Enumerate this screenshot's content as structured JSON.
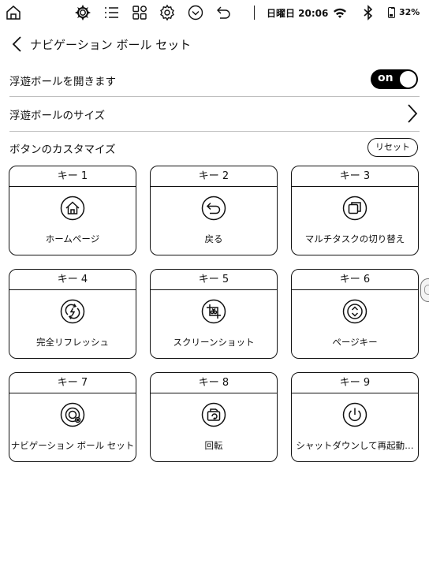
{
  "status_bar": {
    "datetime": "日曜日 20:06",
    "battery_percent": "32%",
    "battery_level": 0.32,
    "icons": [
      "home-outline-icon",
      "gear-flower-icon",
      "list-icon",
      "apps-grid-icon",
      "settings-gear-icon",
      "chevron-circle-icon",
      "undo-arrow-icon",
      "wifi-icon",
      "bluetooth-icon",
      "battery-icon"
    ]
  },
  "header": {
    "title": "ナビゲーション ボール セット"
  },
  "settings": {
    "open_ball_label": "浮遊ボールを開きます",
    "toggle_text": "on",
    "toggle_on": true,
    "ball_size_label": "浮遊ボールのサイズ",
    "customize_label": "ボタンのカスタマイズ",
    "reset_label": "リセット"
  },
  "keys": [
    {
      "title": "キー 1",
      "label": "ホームページ",
      "icon": "home-icon"
    },
    {
      "title": "キー 2",
      "label": "戻る",
      "icon": "back-arrow-icon"
    },
    {
      "title": "キー 3",
      "label": "マルチタスクの切り替え",
      "icon": "multitask-icon"
    },
    {
      "title": "キー 4",
      "label": "完全リフレッシュ",
      "icon": "refresh-icon"
    },
    {
      "title": "キー 5",
      "label": "スクリーンショット",
      "icon": "screenshot-icon"
    },
    {
      "title": "キー 6",
      "label": "ページキー",
      "icon": "page-key-icon"
    },
    {
      "title": "キー 7",
      "label": "ナビゲーション ボール セット",
      "icon": "nav-ball-icon"
    },
    {
      "title": "キー 8",
      "label": "回転",
      "icon": "rotate-icon"
    },
    {
      "title": "キー 9",
      "label": "シャットダウンして再起動…",
      "icon": "power-icon"
    }
  ]
}
